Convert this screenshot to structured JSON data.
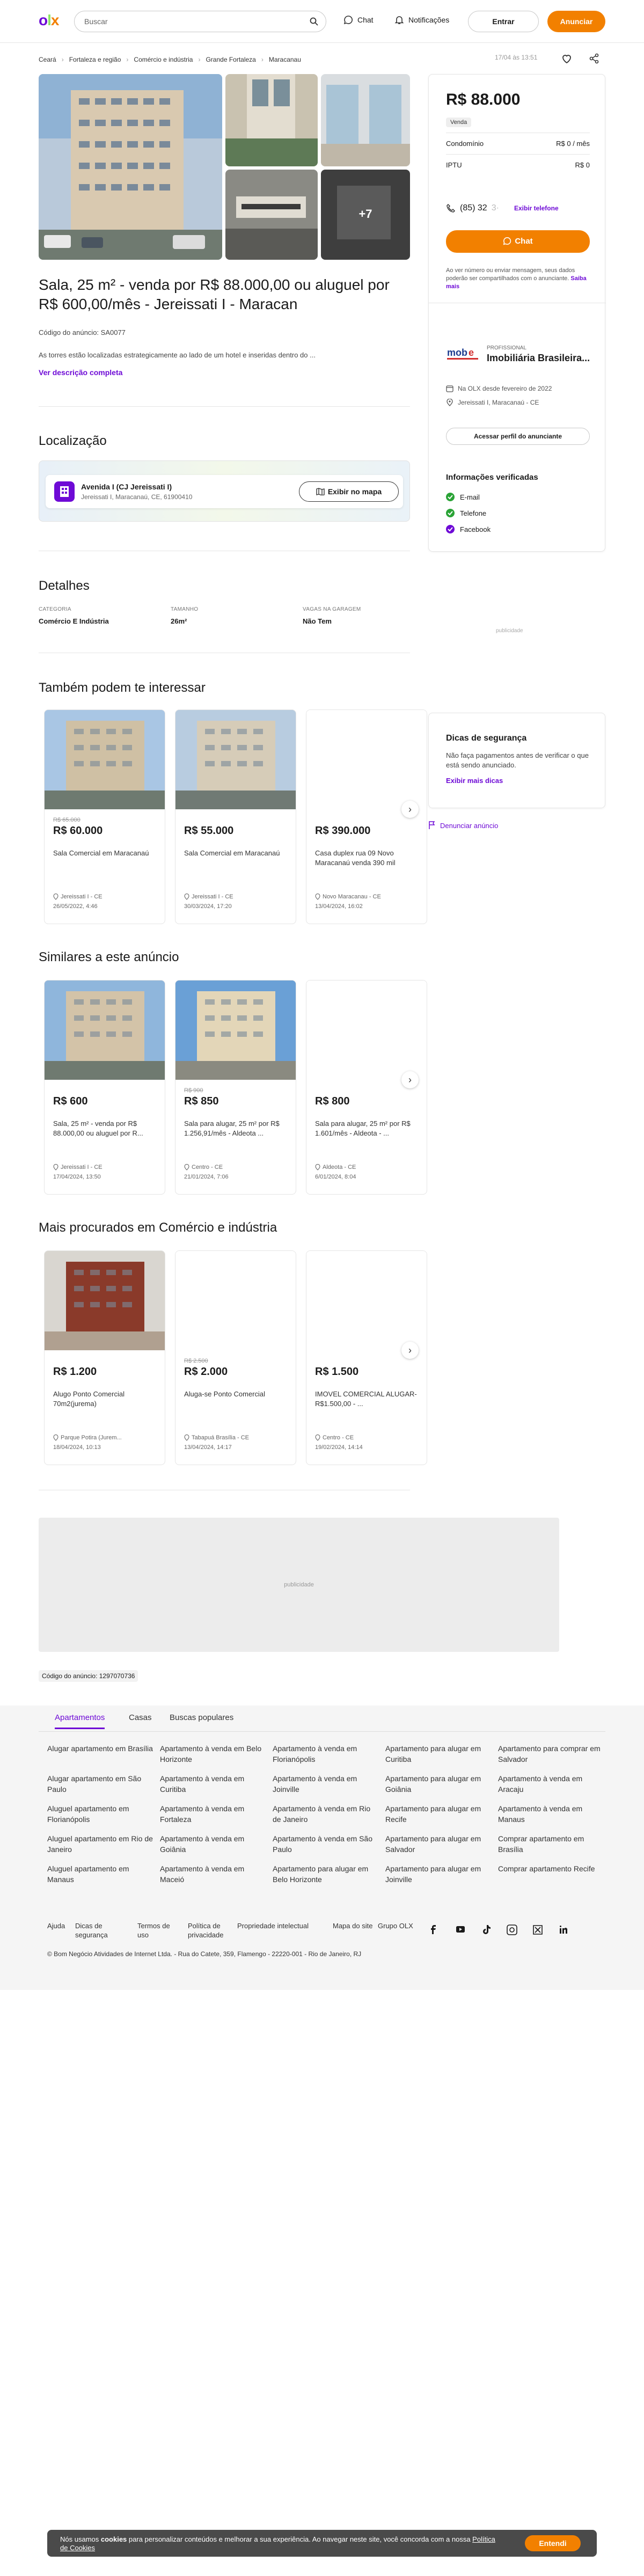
{
  "header": {
    "logo": {
      "o": "o",
      "l": "l",
      "x": "x"
    },
    "search_placeholder": "Buscar",
    "chat": "Chat",
    "notifications": "Notificações",
    "login": "Entrar",
    "advertise": "Anunciar"
  },
  "breadcrumb": [
    "Ceará",
    "Fortaleza e região",
    "Comércio e indústria",
    "Grande Fortaleza",
    "Maracanau"
  ],
  "meta_date": "17/04 às 13:51",
  "gallery": {
    "more": "+7"
  },
  "ad": {
    "title": "Sala, 25 m² - venda por R$ 88.000,00 ou aluguel por R$ 600,00/mês - Jereissati I - Maracan",
    "code": "Código do anúncio: SA0077",
    "description": "As torres estão localizadas estrategicamente ao lado de um hotel e inseridas dentro do ...",
    "see_full": "Ver descrição completa"
  },
  "location": {
    "heading": "Localização",
    "street": "Avenida I (CJ Jereissati I)",
    "detail": "Jereissati I, Maracanaú, CE, 61900410",
    "map_button": "Exibir no mapa"
  },
  "details": {
    "heading": "Detalhes",
    "items": [
      {
        "label": "CATEGORIA",
        "value": "Comércio E Indústria"
      },
      {
        "label": "TAMANHO",
        "value": "26m²"
      },
      {
        "label": "VAGAS NA GARAGEM",
        "value": "Não Tem"
      }
    ],
    "ad_label": "publicidade"
  },
  "sidebar": {
    "price": "R$ 88.000",
    "tag": "Venda",
    "rows": [
      {
        "label": "Condomínio",
        "value": "R$ 0 / mês"
      },
      {
        "label": "IPTU",
        "value": "R$ 0"
      }
    ],
    "phone": "(85) 32",
    "show_phone": "Exibir telefone",
    "chat_button": "Chat",
    "privacy_note": "Ao ver número ou enviar mensagem, seus dados poderão ser compartilhados com o anunciante.",
    "know_more": "Saiba mais",
    "seller_type": "PROFISSIONAL",
    "seller_name": "Imobiliária Brasileira...",
    "seller_since": "Na OLX desde fevereiro de 2022",
    "seller_location": "Jereissati I, Maracanaú - CE",
    "profile_button": "Acessar perfil do anunciante",
    "verified_heading": "Informações verificadas",
    "verified": [
      "E-mail",
      "Telefone",
      "Facebook"
    ]
  },
  "safety": {
    "heading": "Dicas de segurança",
    "text": "Não faça pagamentos antes de verificar o que está sendo anunciado.",
    "more": "Exibir mais dicas",
    "report": "Denunciar anúncio"
  },
  "section1": {
    "heading": "Também podem te interessar",
    "cards": [
      {
        "old": "R$ 65.000",
        "price": "R$ 60.000",
        "desc": "Sala Comercial em Maracanaú",
        "loc": "Jereissati I - CE",
        "date": "26/05/2022, 4:46"
      },
      {
        "old": "",
        "price": "R$ 55.000",
        "desc": "Sala Comercial em Maracanaú",
        "loc": "Jereissati I - CE",
        "date": "30/03/2024, 17:20"
      },
      {
        "old": "",
        "price": "R$ 390.000",
        "desc": "Casa duplex rua 09 Novo Maracanaú venda 390 mil",
        "loc": "Novo Maracanau - CE",
        "date": "13/04/2024, 16:02"
      }
    ]
  },
  "section2": {
    "heading": "Similares a este anúncio",
    "cards": [
      {
        "old": "",
        "price": "R$ 600",
        "desc": "Sala, 25 m² - venda por R$ 88.000,00 ou aluguel por R...",
        "loc": "Jereissati I - CE",
        "date": "17/04/2024, 13:50"
      },
      {
        "old": "R$ 900",
        "price": "R$ 850",
        "desc": "Sala para alugar, 25 m² por R$ 1.256,91/mês - Aldeota ...",
        "loc": "Centro - CE",
        "date": "21/01/2024, 7:06"
      },
      {
        "old": "",
        "price": "R$ 800",
        "desc": "Sala para alugar, 25 m² por R$ 1.601/mês - Aldeota - ...",
        "loc": "Aldeota - CE",
        "date": "6/01/2024, 8:04"
      }
    ]
  },
  "section3": {
    "heading": "Mais procurados em Comércio e indústria",
    "cards": [
      {
        "old": "",
        "price": "R$ 1.200",
        "desc": "Alugo Ponto Comercial 70m2(jurema)",
        "loc": "Parque Potira (Jurem...",
        "date": "18/04/2024, 10:13"
      },
      {
        "old": "R$ 2.500",
        "price": "R$ 2.000",
        "desc": "Aluga-se Ponto Comercial",
        "loc": "Tabapuá Brasília - CE",
        "date": "13/04/2024, 14:17"
      },
      {
        "old": "",
        "price": "R$ 1.500",
        "desc": "IMOVEL COMERCIAL ALUGAR- R$1.500,00 - ...",
        "loc": "Centro - CE",
        "date": "19/02/2024, 14:14"
      }
    ]
  },
  "banner_ad": "publicidade",
  "ad_code_footer": "Código do anúncio: 1297070736",
  "footer": {
    "tabs": [
      "Apartamentos",
      "Casas",
      "Buscas populares"
    ],
    "links": [
      [
        "Alugar apartamento em Brasília",
        "Apartamento à venda em Belo Horizonte",
        "Apartamento à venda em Florianópolis",
        "Apartamento para alugar em Curitiba",
        "Apartamento para comprar em Salvador"
      ],
      [
        "Alugar apartamento em São Paulo",
        "Apartamento à venda em Curitiba",
        "Apartamento à venda em Joinville",
        "Apartamento para alugar em Goiânia",
        "Apartamento à venda em Aracaju"
      ],
      [
        "Aluguel apartamento em Florianópolis",
        "Apartamento à venda em Fortaleza",
        "Apartamento à venda em Rio de Janeiro",
        "Apartamento para alugar em Recife",
        "Apartamento à venda em Manaus"
      ],
      [
        "Aluguel apartamento em Rio de Janeiro",
        "Apartamento à venda em Goiânia",
        "Apartamento à venda em São Paulo",
        "Apartamento para alugar em Salvador",
        "Comprar apartamento em Brasília"
      ],
      [
        "Aluguel apartamento em Manaus",
        "Apartamento à venda em Maceió",
        "Apartamento para alugar em Belo Horizonte",
        "Apartamento para alugar em Joinville",
        "Comprar apartamento Recife"
      ]
    ],
    "bottom_links": [
      "Ajuda",
      "Dicas de segurança",
      "Termos de uso",
      "Política de privacidade",
      "Propriedade intelectual",
      "Mapa do site",
      "Grupo OLX"
    ],
    "copyright": "© Bom Negócio Atividades de Internet Ltda. - Rua do Catete, 359, Flamengo - 22220-001 - Rio de Janeiro, RJ"
  },
  "cookie": {
    "text_pre": "Nós usamos ",
    "text_bold": "cookies",
    "text_post": " para personalizar conteúdos e melhorar a sua experiência. Ao navegar neste site, você concorda com a nossa ",
    "policy": "Política de Cookies",
    "button": "Entendi"
  }
}
